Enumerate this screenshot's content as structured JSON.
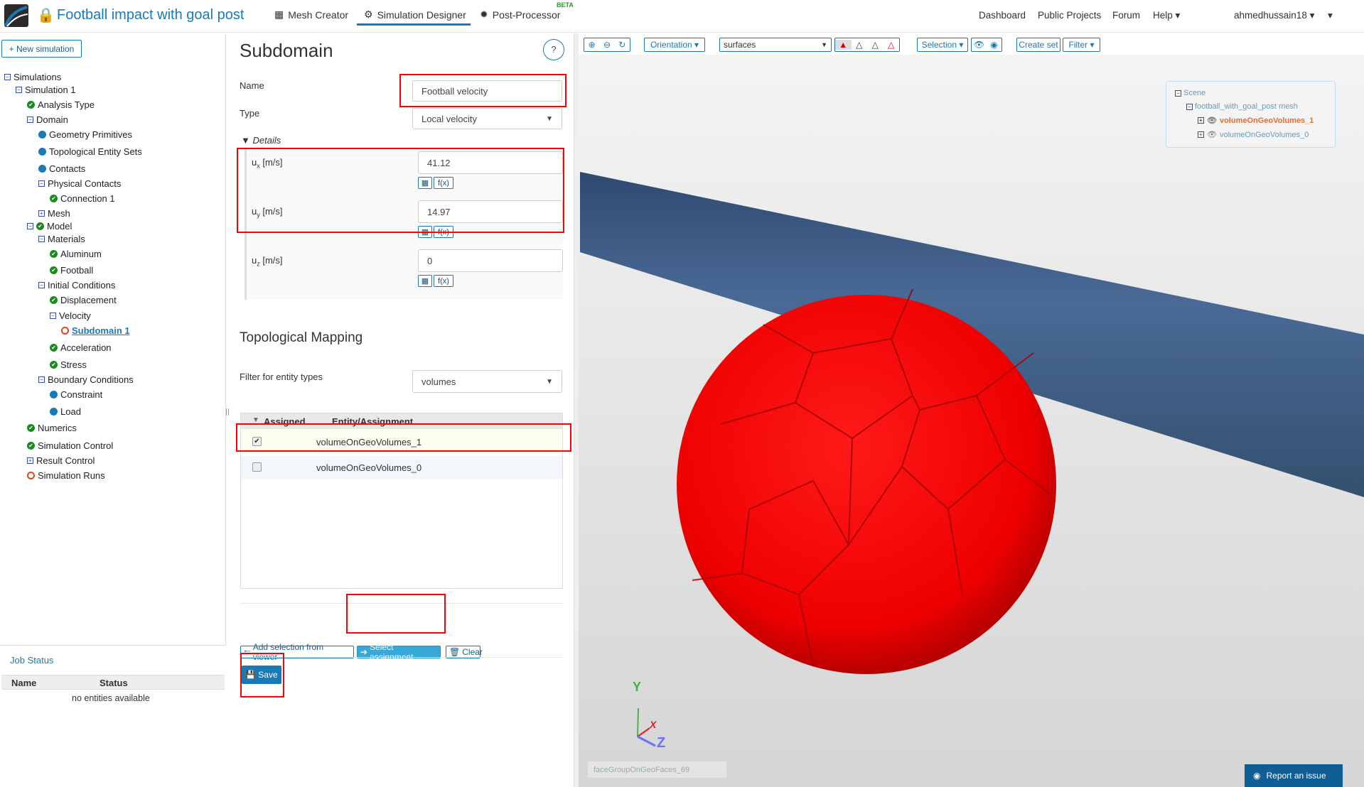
{
  "header": {
    "project_title": "Football impact with goal post",
    "tabs": [
      {
        "label": "Mesh Creator",
        "icon": "grid-icon"
      },
      {
        "label": "Simulation Designer",
        "icon": "gears-icon"
      },
      {
        "label": "Post-Processor",
        "icon": "gear-icon",
        "badge": "BETA"
      }
    ],
    "nav": [
      "Dashboard",
      "Public Projects",
      "Forum",
      "Help"
    ],
    "user": "ahmedhussain18"
  },
  "sidebar": {
    "new_simulation": "New simulation",
    "tree": [
      {
        "label": "Simulations",
        "level": 0,
        "icon": "minus"
      },
      {
        "label": "Simulation 1",
        "level": 1,
        "icon": "minus"
      },
      {
        "label": "Analysis Type",
        "level": 2,
        "icon": "check"
      },
      {
        "label": "Domain",
        "level": 2,
        "icon": "minus"
      },
      {
        "label": "Geometry Primitives",
        "level": 3,
        "icon": "dot"
      },
      {
        "label": "Topological Entity Sets",
        "level": 3,
        "icon": "dot"
      },
      {
        "label": "Contacts",
        "level": 3,
        "icon": "dot"
      },
      {
        "label": "Physical Contacts",
        "level": 3,
        "icon": "minus"
      },
      {
        "label": "Connection 1",
        "level": 4,
        "icon": "check"
      },
      {
        "label": "Mesh",
        "level": 3,
        "icon": "plus"
      },
      {
        "label": "Model",
        "level": 2,
        "icon": "minus-check"
      },
      {
        "label": "Materials",
        "level": 3,
        "icon": "minus"
      },
      {
        "label": "Aluminum",
        "level": 4,
        "icon": "check"
      },
      {
        "label": "Football",
        "level": 4,
        "icon": "check"
      },
      {
        "label": "Initial Conditions",
        "level": 3,
        "icon": "minus"
      },
      {
        "label": "Displacement",
        "level": 4,
        "icon": "check"
      },
      {
        "label": "Velocity",
        "level": 4,
        "icon": "minus"
      },
      {
        "label": "Subdomain 1",
        "level": 5,
        "icon": "ring",
        "active": true
      },
      {
        "label": "Acceleration",
        "level": 4,
        "icon": "check"
      },
      {
        "label": "Stress",
        "level": 4,
        "icon": "check"
      },
      {
        "label": "Boundary Conditions",
        "level": 3,
        "icon": "minus"
      },
      {
        "label": "Constraint",
        "level": 4,
        "icon": "dot"
      },
      {
        "label": "Load",
        "level": 4,
        "icon": "dot"
      },
      {
        "label": "Numerics",
        "level": 2,
        "icon": "check"
      },
      {
        "label": "Simulation Control",
        "level": 2,
        "icon": "check"
      },
      {
        "label": "Result Control",
        "level": 2,
        "icon": "plus"
      },
      {
        "label": "Simulation Runs",
        "level": 2,
        "icon": "ring"
      }
    ],
    "job_status": {
      "title": "Job Status",
      "columns": [
        "Name",
        "Status"
      ],
      "empty": "no entities available"
    }
  },
  "form": {
    "title": "Subdomain",
    "help": "?",
    "name_label": "Name",
    "name_value": "Football velocity",
    "type_label": "Type",
    "type_value": "Local velocity",
    "details_label": "Details",
    "fields": [
      {
        "label": "u",
        "sub": "x",
        "unit": " [m/s]",
        "value": "41.12"
      },
      {
        "label": "u",
        "sub": "y",
        "unit": " [m/s]",
        "value": "14.97"
      },
      {
        "label": "u",
        "sub": "z",
        "unit": " [m/s]",
        "value": "0"
      }
    ],
    "fx": "f(x)",
    "topo_title": "Topological Mapping",
    "filter_label": "Filter for entity types",
    "filter_value": "volumes",
    "table_headers": [
      "Assigned",
      "Entity/Assignment"
    ],
    "rows": [
      {
        "name": "volumeOnGeoVolumes_1",
        "checked": true
      },
      {
        "name": "volumeOnGeoVolumes_0",
        "checked": false
      }
    ],
    "add_selection": "Add selection from viewer",
    "select_assignment": "Select assignment",
    "clear": "Clear",
    "save": "Save"
  },
  "viewer": {
    "orientation": "Orientation",
    "render_mode": "surfaces",
    "selection": "Selection",
    "create_set": "Create set",
    "filter": "Filter",
    "scene": {
      "root": "Scene",
      "mesh": "football_with_goal_post mesh",
      "items": [
        {
          "name": "volumeOnGeoVolumes_1",
          "highlighted": true
        },
        {
          "name": "volumeOnGeoVolumes_0",
          "highlighted": false
        }
      ]
    },
    "axes": {
      "x": "X",
      "y": "Y",
      "z": "Z"
    },
    "hover_label": "faceGroupOnGeoFaces_69",
    "report": "Report an issue",
    "colors": {
      "ball": "#ff0000",
      "beam": "#3d5a80"
    }
  }
}
